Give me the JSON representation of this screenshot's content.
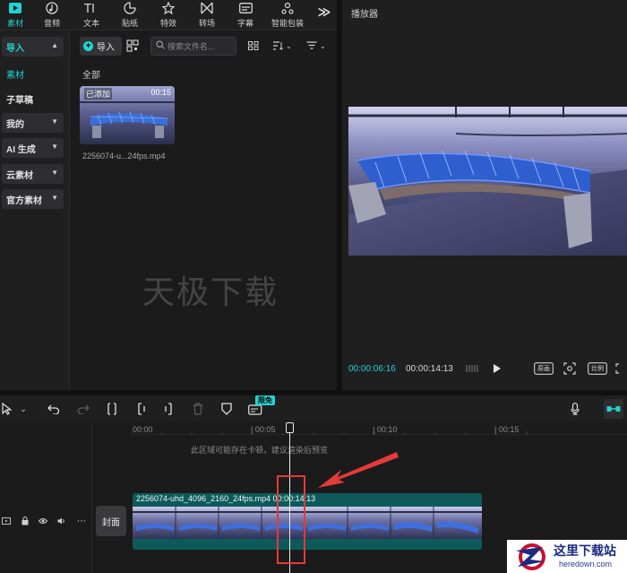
{
  "toolbar": {
    "tools": [
      {
        "label": "素材",
        "icon": "media-icon",
        "active": true
      },
      {
        "label": "音频",
        "icon": "audio-icon"
      },
      {
        "label": "文本",
        "icon": "text-icon"
      },
      {
        "label": "贴纸",
        "icon": "sticker-icon"
      },
      {
        "label": "特效",
        "icon": "effects-icon"
      },
      {
        "label": "转场",
        "icon": "transition-icon"
      },
      {
        "label": "字幕",
        "icon": "subtitle-icon"
      },
      {
        "label": "智能包装",
        "icon": "smart-pack-icon"
      }
    ],
    "more": "≫"
  },
  "leftnav": {
    "import": "导入",
    "material": "素材",
    "draft": "子草稿",
    "mine": "我的",
    "ai": "AI 生成",
    "cloud": "云素材",
    "official": "官方素材"
  },
  "media": {
    "import_label": "导入",
    "search_placeholder": "搜索文件名...",
    "section": "全部",
    "clip": {
      "added": "已添加",
      "duration": "00:15",
      "name": "2256074-u...24fps.mp4"
    },
    "watermark": "天极下载"
  },
  "player": {
    "title": "播放器",
    "current_time": "00:00:06:16",
    "total_time": "00:00:14:13",
    "btn_fit": "原画",
    "btn_ratio": "比例"
  },
  "timeline": {
    "badge": "限免",
    "ruler": [
      "00:00",
      "| 00:05",
      "| 00:10",
      "| 00:15"
    ],
    "notice": "此区域可能存在卡顿，建议渲染后预览",
    "cover": "封面",
    "clip_label": "2256074-uhd_4096_2160_24fps.mp4  00:00:14:13"
  },
  "logo": {
    "title": "这里下载站",
    "subtitle": "heredown.com"
  },
  "colors": {
    "accent": "#22d3cf",
    "annotation": "#e53a3a",
    "bg": "#1b1b1c"
  }
}
